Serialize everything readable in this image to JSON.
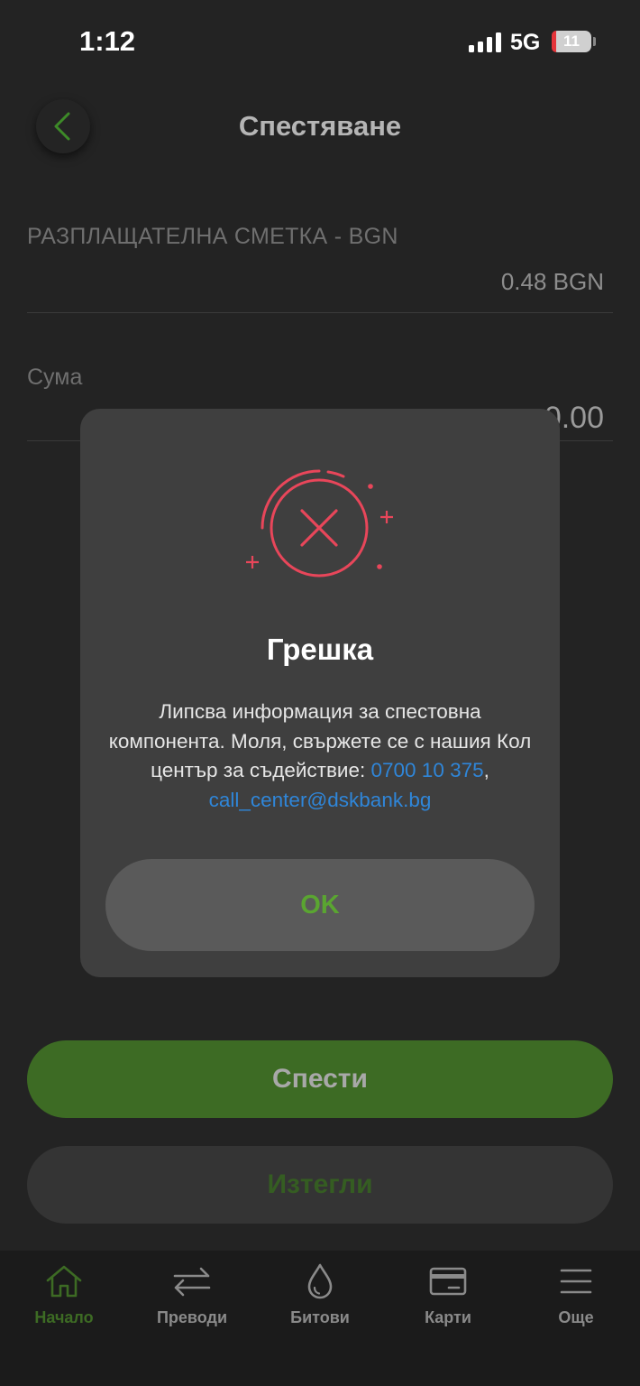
{
  "status_bar": {
    "time": "1:12",
    "network": "5G",
    "battery": "11",
    "battery_level": 0.11
  },
  "header": {
    "title": "Спестяване",
    "back_icon": "chevron-left-icon"
  },
  "account": {
    "name": "РАЗПЛАЩАТЕЛНА СМЕТКА - BGN",
    "balance": "0.48  BGN"
  },
  "amount": {
    "label": "Сума",
    "value": "0.00"
  },
  "actions": {
    "save_label": "Спести",
    "withdraw_label": "Изтегли"
  },
  "dialog": {
    "icon": "error-x-circle-icon",
    "title": "Грешка",
    "message_prefix": "Липсва информация за спестовна компонента. Моля, свържете се с нашия Кол център за съдействие: ",
    "phone": "0700 10 375",
    "separator": ", ",
    "email": "call_center@dskbank.bg",
    "ok_label": "OK"
  },
  "bottom_nav": {
    "items": [
      {
        "label": "Начало",
        "icon": "home-icon",
        "active": true
      },
      {
        "label": "Преводи",
        "icon": "transfer-arrows-icon",
        "active": false
      },
      {
        "label": "Битови",
        "icon": "drop-icon",
        "active": false
      },
      {
        "label": "Карти",
        "icon": "card-icon",
        "active": false
      },
      {
        "label": "Още",
        "icon": "menu-icon",
        "active": false
      }
    ]
  },
  "colors": {
    "background": "#232323",
    "accent_green": "#3d6b24",
    "ok_green": "#5aa531",
    "error_red": "#e8465a",
    "link_blue": "#2f86d9"
  }
}
